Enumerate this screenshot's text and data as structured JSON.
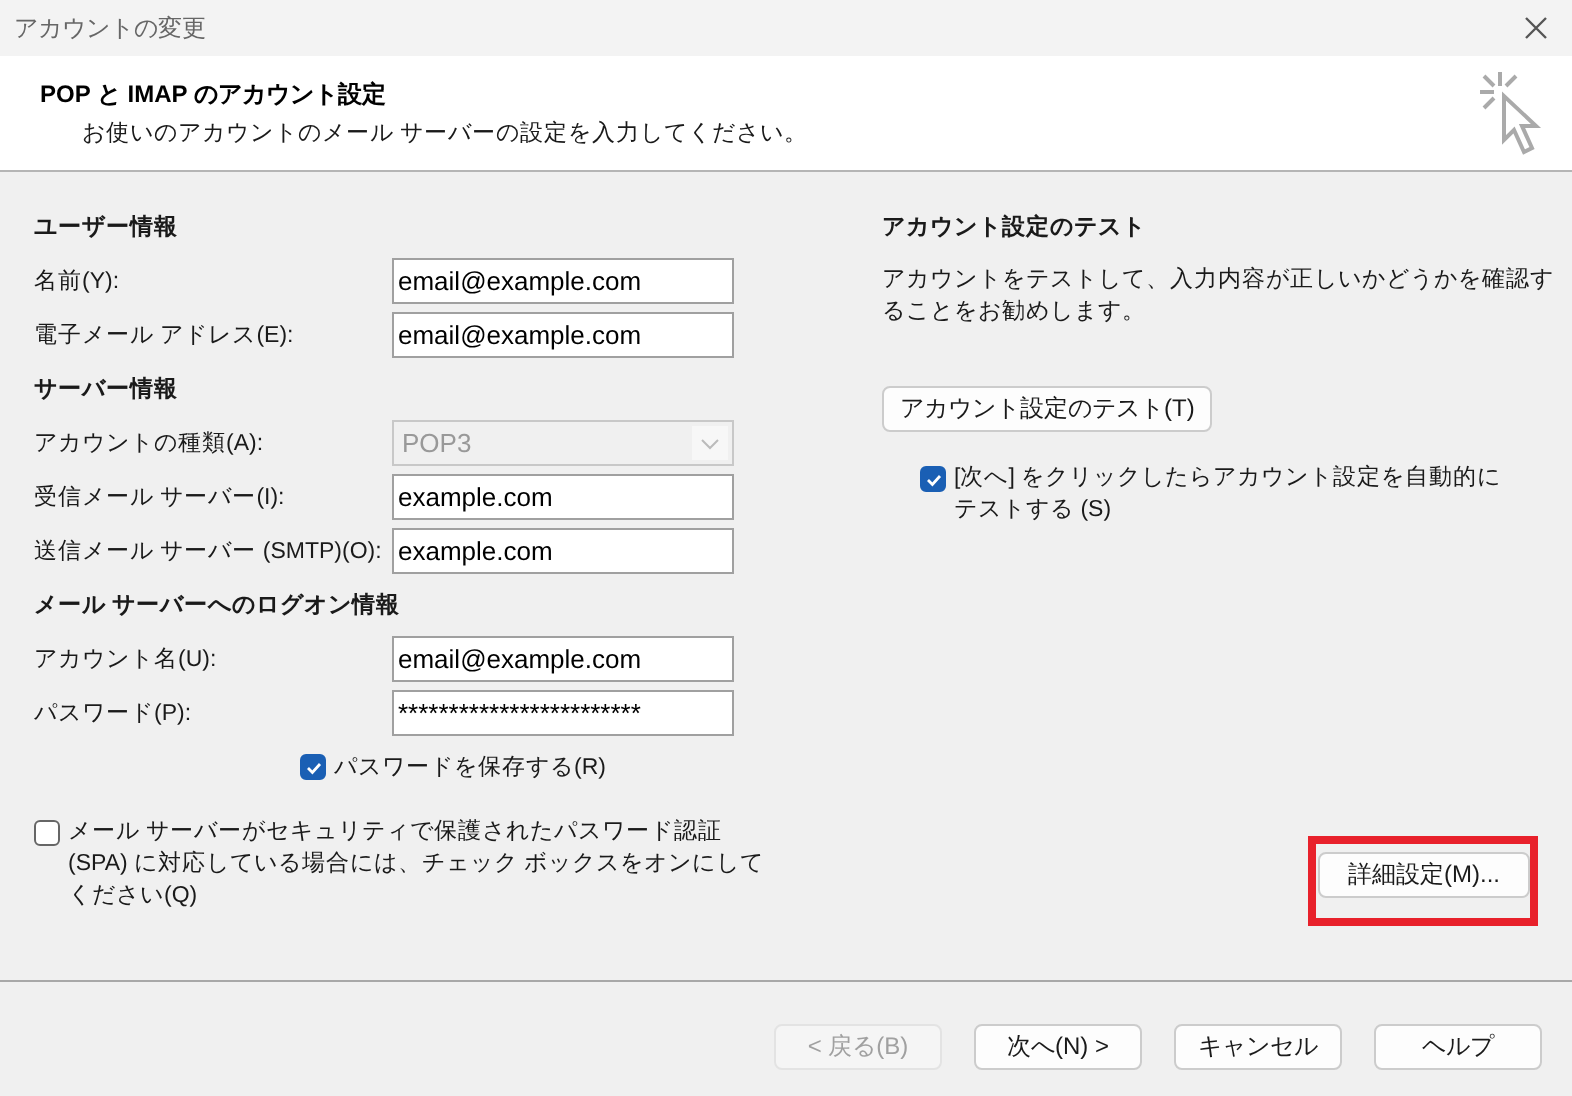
{
  "window": {
    "title": "アカウントの変更"
  },
  "header": {
    "title": "POP と IMAP のアカウント設定",
    "subtitle": "お使いのアカウントのメール サーバーの設定を入力してください。"
  },
  "left_sections": [
    {
      "title": "ユーザー情報",
      "fields": [
        {
          "label": "名前(Y):",
          "kind": "text",
          "value": "email@example.com",
          "disabled": false
        },
        {
          "label": "電子メール アドレス(E):",
          "kind": "text",
          "value": "email@example.com",
          "disabled": false
        }
      ]
    },
    {
      "title": "サーバー情報",
      "fields": [
        {
          "label": "アカウントの種類(A):",
          "kind": "select",
          "value": "POP3",
          "disabled": true
        },
        {
          "label": "受信メール サーバー(I):",
          "kind": "text",
          "value": "example.com",
          "disabled": false
        },
        {
          "label": "送信メール サーバー (SMTP)(O):",
          "kind": "text",
          "value": "example.com",
          "disabled": false
        }
      ]
    },
    {
      "title": "メール サーバーへのログオン情報",
      "fields": [
        {
          "label": "アカウント名(U):",
          "kind": "text",
          "value": "email@example.com",
          "disabled": false
        },
        {
          "label": "パスワード(P):",
          "kind": "password",
          "value": "************************",
          "disabled": false
        }
      ]
    }
  ],
  "save_password": {
    "label": "パスワードを保存する(R)",
    "checked": true
  },
  "spa": {
    "label": "メール サーバーがセキュリティで保護されたパスワード認証 (SPA) に対応している場合には、チェック ボックスをオンにしてください(Q)",
    "checked": false
  },
  "test": {
    "title": "アカウント設定のテスト",
    "description": "アカウントをテストして、入力内容が正しいかどうかを確認することをお勧めします。",
    "button": "アカウント設定のテスト(T)",
    "auto_test": {
      "label": "[次へ] をクリックしたらアカウント設定を自動的にテストする (S)",
      "checked": true
    }
  },
  "advanced_button": {
    "label": "詳細設定(M)...",
    "highlighted": true
  },
  "footer_buttons": [
    {
      "label": "< 戻る(B)",
      "disabled": true
    },
    {
      "label": "次へ(N) >",
      "disabled": false
    },
    {
      "label": "キャンセル",
      "disabled": false
    },
    {
      "label": "ヘルプ",
      "disabled": false
    }
  ]
}
